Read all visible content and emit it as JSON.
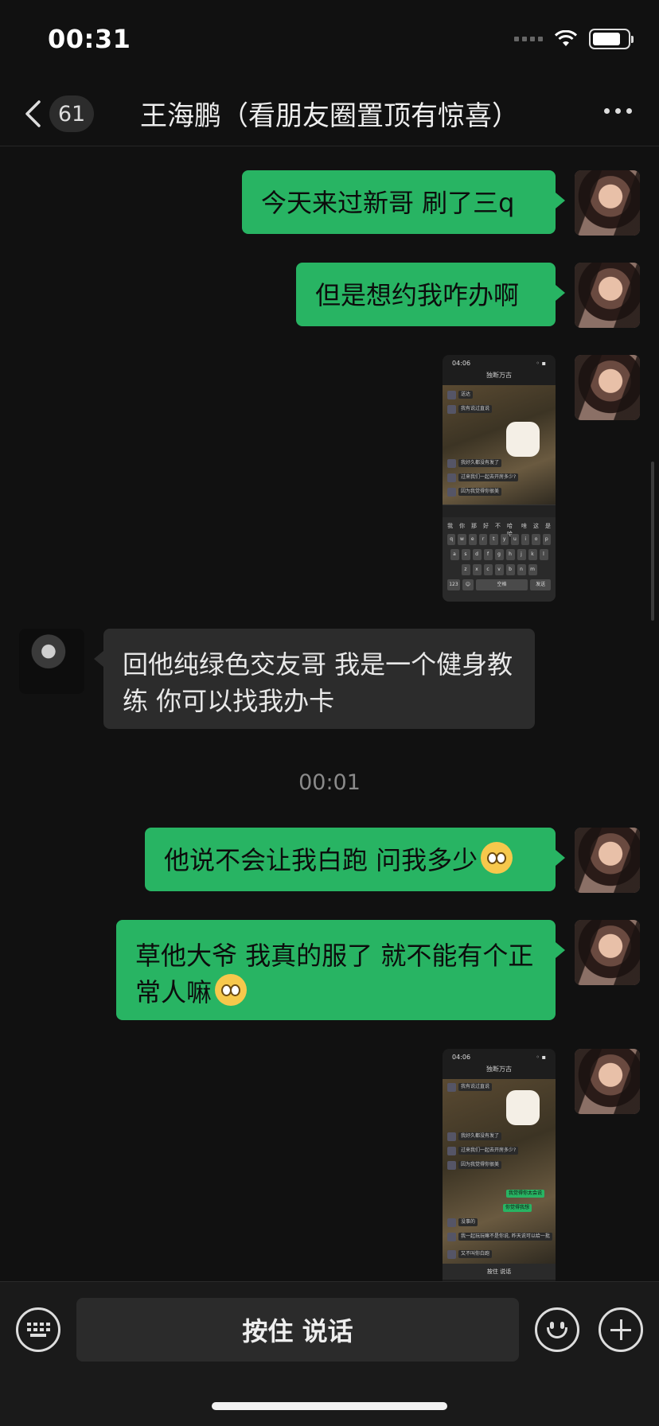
{
  "status_bar": {
    "time": "00:31"
  },
  "nav": {
    "unread_count": "61",
    "title": "王海鹏（看朋友圈置顶有惊喜）"
  },
  "messages": [
    {
      "side": "out",
      "text": "今天来过新哥 刷了三q"
    },
    {
      "side": "out",
      "text": "但是想约我咋办啊"
    },
    {
      "side": "out",
      "type": "image"
    },
    {
      "side": "in",
      "text": "回他纯绿色交友哥 我是一个健身教练 你可以找我办卡"
    },
    {
      "side": "out",
      "text": "他说不会让我白跑 问我多少",
      "emoji": "smile"
    },
    {
      "side": "out",
      "text": "草他大爷 我真的服了 就不能有个正常人嘛",
      "emoji": "smile"
    },
    {
      "side": "out",
      "type": "image"
    }
  ],
  "timestamp": "00:01",
  "shot1": {
    "time": "04:06",
    "title": "独断万古",
    "rows": [
      "送达",
      "我有说过直说",
      "我好久都没有发了",
      "过来我们一起去开房多少?",
      "因为我觉得你很美"
    ],
    "suggestions": [
      "我",
      "你",
      "那",
      "好",
      "不",
      "哈哈",
      "啥",
      "这",
      "是"
    ],
    "kb_row1": [
      "p",
      "q",
      "w",
      "e",
      "r",
      "t",
      "y",
      "u",
      "i",
      "o",
      "p"
    ],
    "kb_row2": [
      "a",
      "s",
      "d",
      "f",
      "g",
      "h",
      "j",
      "k",
      "l"
    ],
    "kb_row3": [
      "z",
      "x",
      "c",
      "v",
      "b",
      "n",
      "m"
    ],
    "space": "空格",
    "send": "发送"
  },
  "shot2": {
    "time": "04:06",
    "title": "独断万古",
    "rows": [
      "我有说过直说",
      "我好久都没有发了",
      "过来我们一起去开房多少?",
      "因为我觉得你很美",
      "没事的",
      "我一起玩玩嘛不是你说, 昨天说可以给一批",
      "又不叫你白跑"
    ],
    "green": [
      "我觉得你太会说",
      "你觉得我想"
    ],
    "bottom": "按住 说话"
  },
  "bottom_bar": {
    "hold_to_talk": "按住 说话"
  },
  "colors": {
    "bubble_out": "#28b463",
    "bubble_in": "#2c2c2c",
    "background": "#111111"
  }
}
